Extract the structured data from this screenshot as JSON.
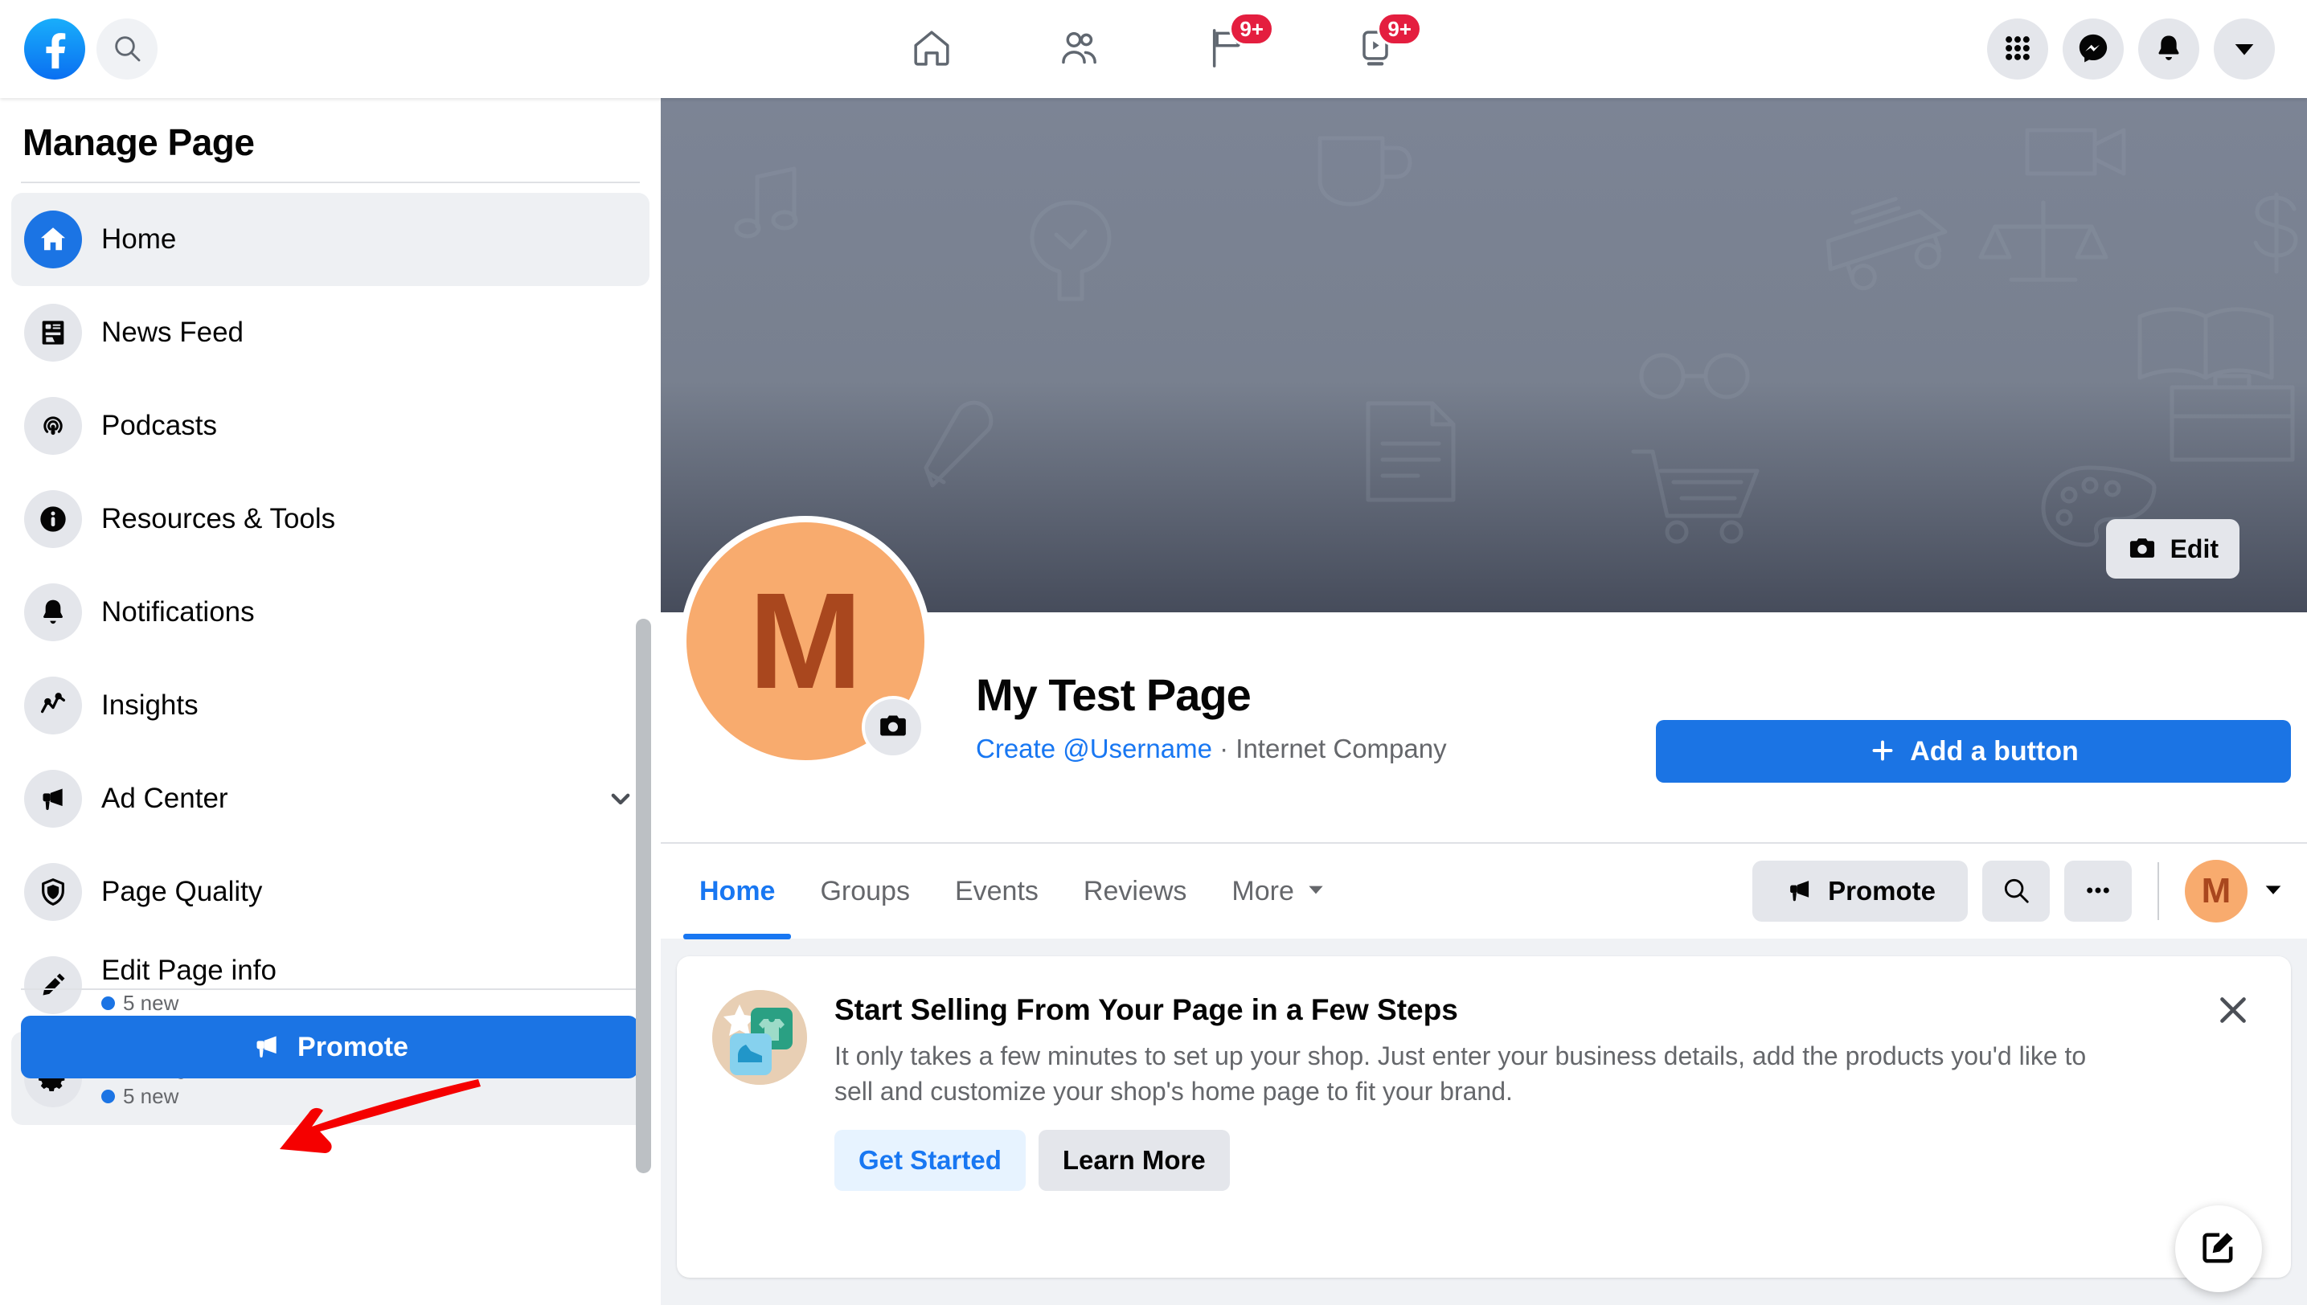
{
  "topnav": {
    "logo_icon": "facebook-logo-icon",
    "search_icon": "search-icon",
    "tabs": [
      {
        "icon": "home-icon",
        "name": "home",
        "badge": ""
      },
      {
        "icon": "friends-icon",
        "name": "friends",
        "badge": ""
      },
      {
        "icon": "pages-flag-icon",
        "name": "pages",
        "badge": "9+"
      },
      {
        "icon": "watch-video-icon",
        "name": "watch",
        "badge": "9+"
      }
    ],
    "right_buttons": [
      {
        "icon": "grid-menu-icon",
        "name": "menu"
      },
      {
        "icon": "messenger-icon",
        "name": "messenger"
      },
      {
        "icon": "bell-icon",
        "name": "notifications"
      },
      {
        "icon": "chevron-down-icon",
        "name": "account"
      }
    ]
  },
  "sidebar": {
    "title": "Manage Page",
    "items": [
      {
        "label": "Home",
        "icon": "home-icon",
        "active": true,
        "badge": "",
        "chevron": false
      },
      {
        "label": "News Feed",
        "icon": "news-feed-icon",
        "active": false,
        "badge": "",
        "chevron": false
      },
      {
        "label": "Podcasts",
        "icon": "podcast-icon",
        "active": false,
        "badge": "",
        "chevron": false
      },
      {
        "label": "Resources & Tools",
        "icon": "info-icon",
        "active": false,
        "badge": "",
        "chevron": false
      },
      {
        "label": "Notifications",
        "icon": "bell-icon",
        "active": false,
        "badge": "",
        "chevron": false
      },
      {
        "label": "Insights",
        "icon": "insights-chart-icon",
        "active": false,
        "badge": "",
        "chevron": false
      },
      {
        "label": "Ad Center",
        "icon": "megaphone-icon",
        "active": false,
        "badge": "",
        "chevron": true
      },
      {
        "label": "Page Quality",
        "icon": "shield-icon",
        "active": false,
        "badge": "",
        "chevron": false
      },
      {
        "label": "Edit Page info",
        "icon": "pencil-icon",
        "active": false,
        "badge": "5 new",
        "chevron": false
      },
      {
        "label": "Settings",
        "icon": "gear-icon",
        "active": true,
        "badge": "5 new",
        "chevron": false
      }
    ],
    "promote_label": "Promote",
    "promote_icon": "megaphone-icon"
  },
  "cover": {
    "edit_label": "Edit",
    "edit_icon": "camera-icon"
  },
  "profile": {
    "avatar_letter": "M",
    "avatar_camera_icon": "camera-icon",
    "page_title": "My Test Page",
    "create_username_link": "Create @Username",
    "separator": " · ",
    "category": "Internet Company",
    "add_button_label": "Add a button",
    "add_button_icon": "plus-icon"
  },
  "tabbar": {
    "tabs": [
      {
        "label": "Home",
        "active": true
      },
      {
        "label": "Groups",
        "active": false
      },
      {
        "label": "Events",
        "active": false
      },
      {
        "label": "Reviews",
        "active": false
      },
      {
        "label": "More",
        "active": false,
        "chevron": true
      }
    ],
    "promote_label": "Promote",
    "promote_icon": "megaphone-icon",
    "search_icon": "search-icon",
    "more_icon": "ellipsis-icon",
    "avatar_letter": "M",
    "avatar_chevron_icon": "chevron-down-icon"
  },
  "promo": {
    "thumb_icon": "shop-products-icon",
    "heading": "Start Selling From Your Page in a Few Steps",
    "body": "It only takes a few minutes to set up your shop. Just enter your business details, add the products you'd like to sell and customize your shop's home page to fit your brand.",
    "get_started_label": "Get Started",
    "learn_more_label": "Learn More",
    "close_icon": "close-icon"
  },
  "fab": {
    "icon": "compose-edit-icon"
  },
  "annotation": {
    "arrow_icon": "red-arrow-icon",
    "color": "#f50000"
  },
  "colors": {
    "brand_blue": "#1877f2",
    "button_blue": "#1b74e4",
    "badge_red": "#e41e3f",
    "grey_button": "#e4e6eb",
    "page_bg": "#f0f2f5",
    "avatar_orange": "#f8ab6e",
    "avatar_letter": "#a9471e",
    "text_primary": "#050505",
    "text_secondary": "#65676b"
  }
}
